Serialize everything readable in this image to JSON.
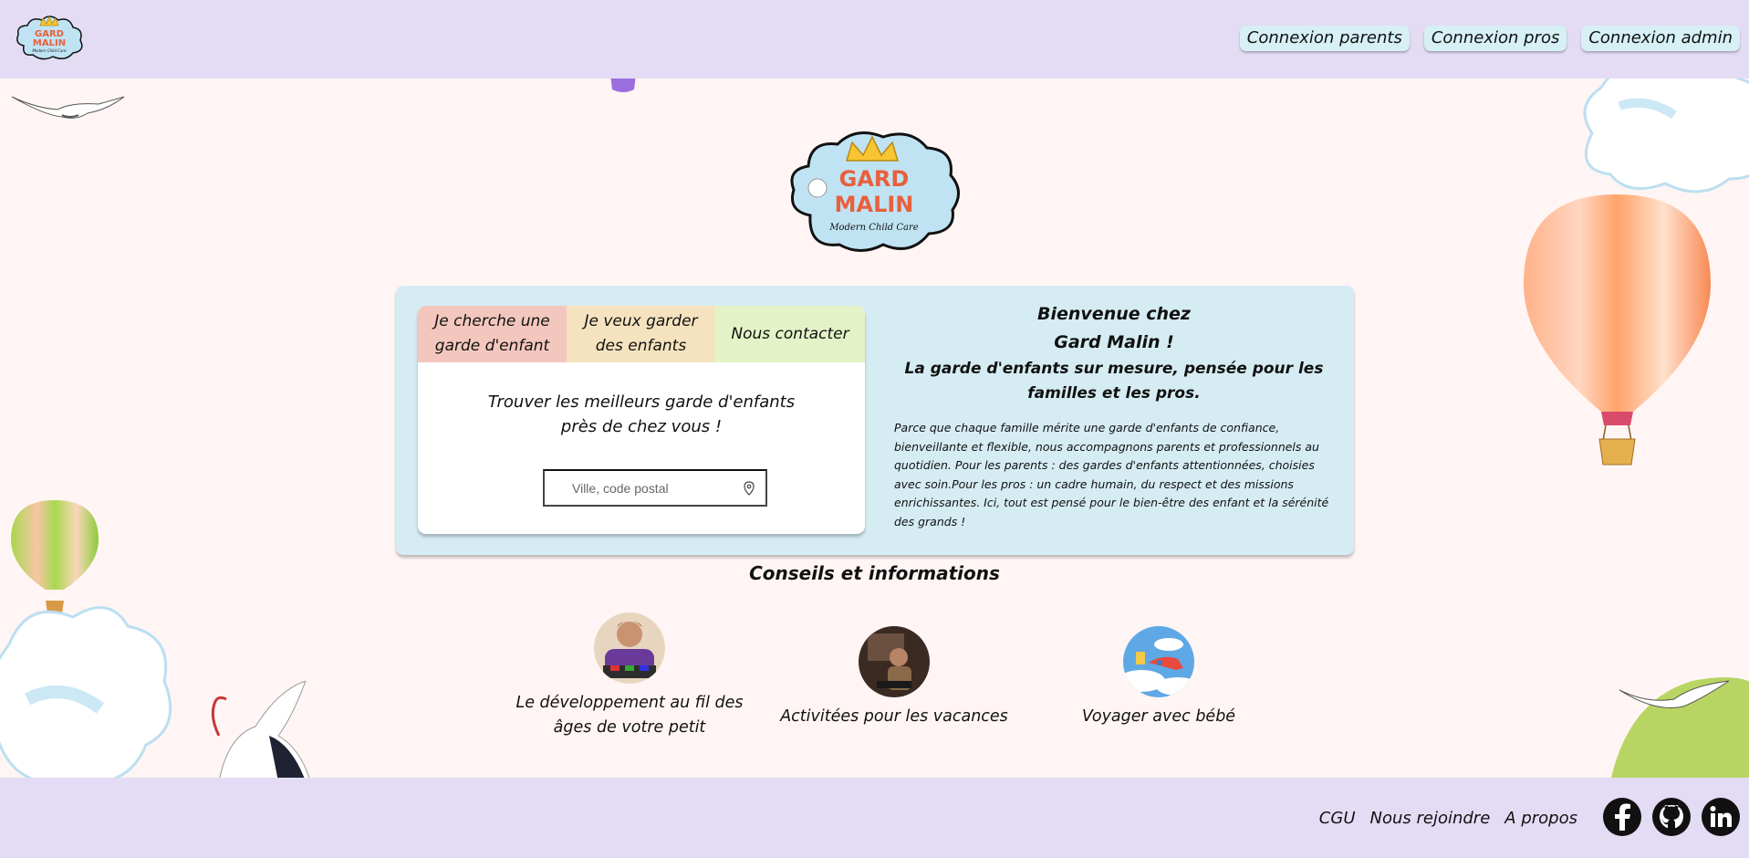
{
  "header": {
    "logo": {
      "line1": "GARD",
      "line2": "MALIN",
      "tagline": "Modern Child Care"
    },
    "nav": {
      "parents": "Connexion parents",
      "pros": "Connexion pros",
      "admin": "Connexion admin"
    }
  },
  "hero": {
    "logo": {
      "line1": "GARD",
      "line2": "MALIN",
      "tagline": "Modern Child Care"
    }
  },
  "card": {
    "tabs": {
      "tab1_line1": "Je cherche une",
      "tab1_line2": "garde d'enfant",
      "tab2_line1": "Je veux garder",
      "tab2_line2": "des enfants",
      "tab3": "Nous contacter"
    },
    "panel": {
      "title_line1": "Trouver les meilleurs garde d'enfants",
      "title_line2": "près de chez vous !",
      "search_placeholder": "Ville, code postal"
    },
    "welcome": {
      "title_line1": "Bienvenue chez",
      "title_line2": "Gard Malin !",
      "subtitle": "La garde d'enfants sur mesure, pensée pour les familles et les pros.",
      "text": "Parce que chaque famille mérite une garde d'enfants de confiance, bienveillante et flexible, nous accompagnons parents et professionnels au quotidien. Pour les parents : des gardes d'enfants attentionnées, choisies avec soin.Pour les pros : un cadre humain, du respect et des missions enrichissantes. Ici, tout est pensé pour le bien-être des enfant et la sérénité des grands !"
    }
  },
  "conseils": {
    "title": "Conseils et informations",
    "items": [
      {
        "label_line1": "Le développement au fil des",
        "label_line2": "âges de votre petit"
      },
      {
        "label_line1": "Activitées pour les vacances"
      },
      {
        "label_line1": "Voyager avec bébé"
      }
    ]
  },
  "footer": {
    "cgu": "CGU",
    "join": "Nous rejoindre",
    "about": "A propos",
    "social": [
      "facebook-icon",
      "github-icon",
      "linkedin-icon"
    ]
  },
  "colors": {
    "header_bg": "#e3dcf4",
    "page_bg": "#fff5f4",
    "card_bg": "#d6ecf3",
    "tab1": "#f3c7bd",
    "tab2": "#f5e3bf",
    "tab3": "#e4f3c7",
    "nav_btn": "#d6f0f5"
  }
}
